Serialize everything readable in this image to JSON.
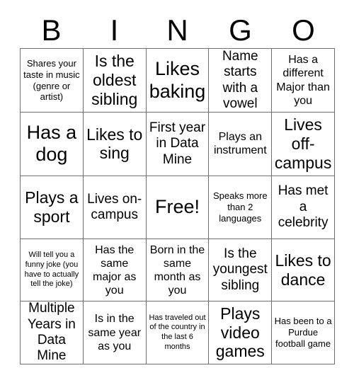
{
  "card": {
    "title": "BINGO",
    "header_letters": [
      "B",
      "I",
      "N",
      "G",
      "O"
    ],
    "grid_rows": 5,
    "grid_cols": 5,
    "border_color": "#6f6f6f",
    "text_color": "#000000",
    "background_color": "#ffffff",
    "free_space": {
      "row": 2,
      "col": 2,
      "label": "Free!"
    },
    "rows": [
      [
        {
          "text": "Shares your taste in music (genre or artist)",
          "size": "sm"
        },
        {
          "text": "Is the oldest sibling",
          "size": "xl"
        },
        {
          "text": "Likes baking",
          "size": "xxl"
        },
        {
          "text": "Name starts with a vowel",
          "size": "lg"
        },
        {
          "text": "Has a different Major than you",
          "size": "md"
        }
      ],
      [
        {
          "text": "Has a dog",
          "size": "xxl"
        },
        {
          "text": "Likes to sing",
          "size": "xl"
        },
        {
          "text": "First year in Data Mine",
          "size": "lg"
        },
        {
          "text": "Plays an instrument",
          "size": "md"
        },
        {
          "text": "Lives off-campus",
          "size": "xl"
        }
      ],
      [
        {
          "text": "Plays a sport",
          "size": "xl"
        },
        {
          "text": "Lives on-campus",
          "size": "lg"
        },
        {
          "text": "Free!",
          "size": "xxl"
        },
        {
          "text": "Speaks more than 2 languages",
          "size": "sm"
        },
        {
          "text": "Has met a celebrity",
          "size": "lg"
        }
      ],
      [
        {
          "text": "Will tell you a funny joke (you have to actually tell the joke)",
          "size": "xs"
        },
        {
          "text": "Has the same major as you",
          "size": "md"
        },
        {
          "text": "Born in the same month as you",
          "size": "md"
        },
        {
          "text": "Is the youngest sibling",
          "size": "lg"
        },
        {
          "text": "Likes to dance",
          "size": "xl"
        }
      ],
      [
        {
          "text": "Multiple Years in Data Mine",
          "size": "lg"
        },
        {
          "text": "Is in the same year as you",
          "size": "md"
        },
        {
          "text": "Has traveled out of the country in the last 6 months",
          "size": "xs"
        },
        {
          "text": "Plays video games",
          "size": "xl"
        },
        {
          "text": "Has been to a Purdue football game",
          "size": "sm"
        }
      ]
    ]
  }
}
